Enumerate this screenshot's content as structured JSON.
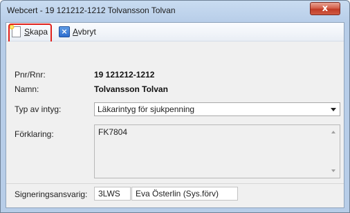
{
  "window": {
    "title": "Webcert - 19 121212-1212 Tolvansson Tolvan",
    "close_glyph": "x"
  },
  "toolbar": {
    "create_label": "Skapa",
    "cancel_label": "Avbryt",
    "create_icon": "new-document-icon",
    "cancel_icon": "cancel-x-icon",
    "highlight_color": "#e0201b"
  },
  "form": {
    "pnr_label": "Pnr/Rnr:",
    "pnr_value": "19 121212-1212",
    "name_label": "Namn:",
    "name_value": "Tolvansson Tolvan",
    "type_label": "Typ av intyg:",
    "type_value": "Läkarintyg för sjukpenning",
    "explanation_label": "Förklaring:",
    "explanation_value": "FK7804",
    "signer_label": "Signeringsansvarig:",
    "signer_code": "3LWS",
    "signer_name": "Eva Österlin (Sys.förv)"
  }
}
